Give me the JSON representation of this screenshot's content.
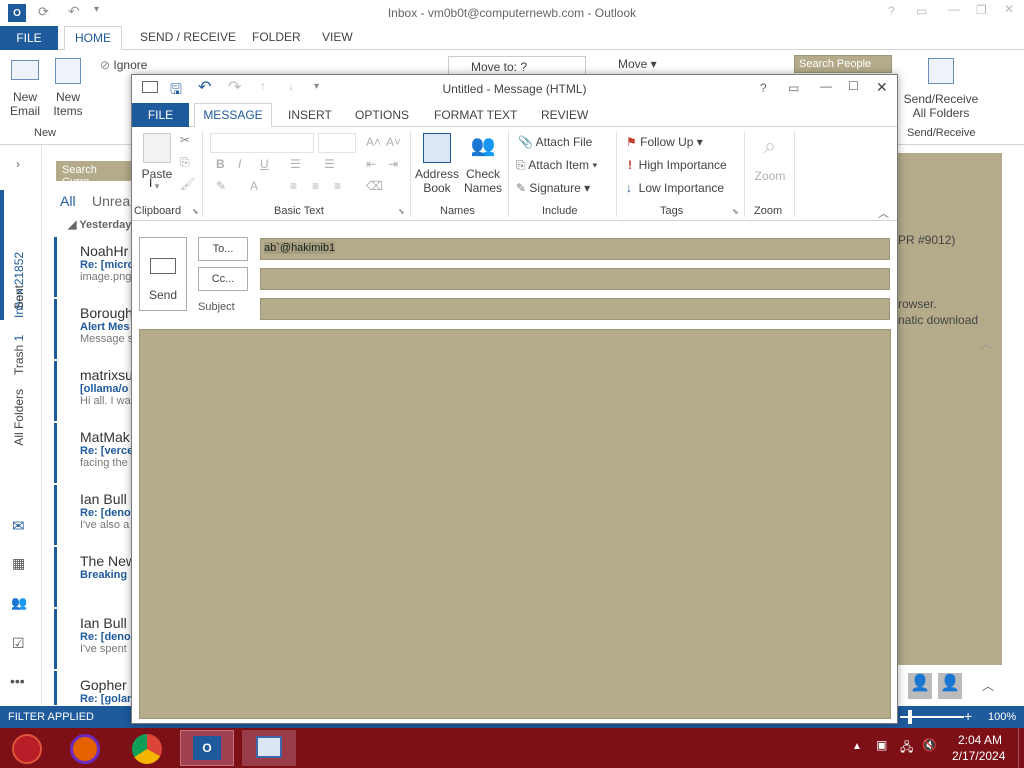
{
  "outlook": {
    "title": "Inbox - vm0b0t@computernewb.com - Outlook",
    "tabs": [
      "FILE",
      "HOME",
      "SEND / RECEIVE",
      "FOLDER",
      "VIEW"
    ],
    "ribbon": {
      "new_email": "New Email",
      "new_email_l1": "New",
      "new_email_l2": "Email",
      "new_items_l1": "New",
      "new_items_l2": "Items",
      "group_new": "New",
      "ignore": "Ignore",
      "move_to": "Move to: ?",
      "move": "Move",
      "search_people": "Search People",
      "send_receive_l1": "Send/Receive",
      "send_receive_l2": "All Folders",
      "group_send_receive": "Send/Receive"
    },
    "nav": {
      "inbox": "Inbox",
      "inbox_count": "21852",
      "sent": "Sent",
      "trash": "Trash",
      "trash_count": "1",
      "all_folders": "All Folders"
    },
    "list": {
      "search_placeholder": "Search Curre",
      "filter_all": "All",
      "filter_unread": "Unrea",
      "group": "Yesterday",
      "items": [
        {
          "from": "NoahHr",
          "subject": "Re: [micro",
          "preview": "image.png"
        },
        {
          "from": "Borough",
          "subject": "Alert Mes",
          "preview": "Message s"
        },
        {
          "from": "matrixsu",
          "subject": "[ollama/o",
          "preview": "Hi all. I wa"
        },
        {
          "from": "MatMak",
          "subject": "Re: [verce",
          "preview": "facing the"
        },
        {
          "from": "Ian Bull",
          "subject": "Re: [deno",
          "preview": "I've also a"
        },
        {
          "from": "The New",
          "subject": "Breaking",
          "preview": ""
        },
        {
          "from": "Ian Bull",
          "subject": "Re: [deno",
          "preview": "I've spent"
        },
        {
          "from": "Gopher",
          "subject": "Re: [golar",
          "preview": ""
        }
      ]
    },
    "reading": {
      "line1": "PR #9012)",
      "line2": "rowser.",
      "line3": "natic download"
    },
    "status": {
      "filter": "FILTER APPLIED",
      "zoom": "100%"
    }
  },
  "message_window": {
    "title": "Untitled - Message (HTML)",
    "tabs": [
      "FILE",
      "MESSAGE",
      "INSERT",
      "OPTIONS",
      "FORMAT TEXT",
      "REVIEW"
    ],
    "ribbon": {
      "paste": "Paste",
      "group_clipboard": "Clipboard",
      "group_basic_text": "Basic Text",
      "address_book_l1": "Address",
      "address_book_l2": "Book",
      "check_names_l1": "Check",
      "check_names_l2": "Names",
      "group_names": "Names",
      "attach_file": "Attach File",
      "attach_item": "Attach Item",
      "signature": "Signature",
      "group_include": "Include",
      "follow_up": "Follow Up",
      "high_importance": "High Importance",
      "low_importance": "Low Importance",
      "group_tags": "Tags",
      "zoom": "Zoom",
      "group_zoom": "Zoom"
    },
    "compose": {
      "send": "Send",
      "to_button": "To...",
      "cc_button": "Cc...",
      "subject_label": "Subject",
      "to_value": "ab`@hakimib1",
      "cc_value": "",
      "subject_value": ""
    }
  },
  "taskbar": {
    "time": "2:04 AM",
    "date": "2/17/2024"
  },
  "colors": {
    "accent": "#1e5a9c",
    "field_bg": "#b3ab8a",
    "taskbar": "#7d0f17"
  }
}
